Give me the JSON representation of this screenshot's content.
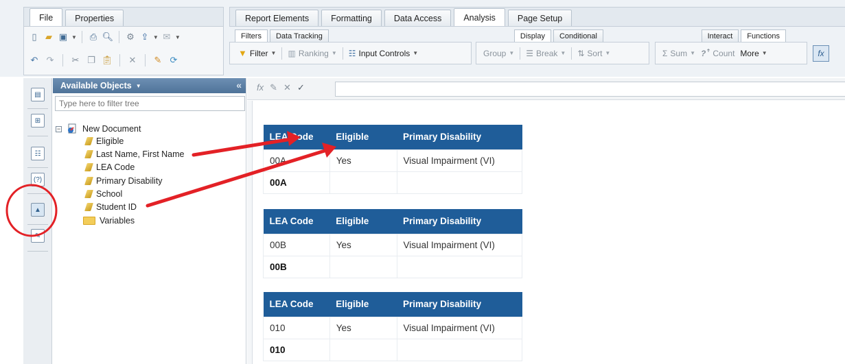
{
  "ribbon": {
    "left_tabs": [
      "File",
      "Properties"
    ],
    "main_tabs": [
      "Report Elements",
      "Formatting",
      "Data Access",
      "Analysis",
      "Page Setup"
    ],
    "active_main_tab": "Analysis",
    "subtabs_left": [
      "Filters",
      "Data Tracking"
    ],
    "subtabs_mid": [
      "Display",
      "Conditional"
    ],
    "subtabs_right": [
      "Interact",
      "Functions"
    ],
    "filter_label": "Filter",
    "ranking_label": "Ranking",
    "input_controls_label": "Input Controls",
    "group_label": "Group",
    "break_label": "Break",
    "sort_label": "Sort",
    "sum_label": "Sum",
    "count_label": "Count",
    "more_label": "More"
  },
  "available_objects": {
    "title": "Available Objects",
    "filter_placeholder": "Type here to filter tree",
    "root": "New Document",
    "items": [
      "Eligible",
      "Last Name, First Name",
      "LEA Code",
      "Primary Disability",
      "School",
      "Student ID"
    ],
    "folder": "Variables"
  },
  "report": {
    "headers": [
      "LEA Code",
      "Eligible",
      "Primary Disability"
    ],
    "tables": [
      {
        "code": "00A",
        "eligible": "Yes",
        "disability": "Visual Impairment (VI)",
        "footer": "00A"
      },
      {
        "code": "00B",
        "eligible": "Yes",
        "disability": "Visual Impairment (VI)",
        "footer": "00B"
      },
      {
        "code": "010",
        "eligible": "Yes",
        "disability": "Visual Impairment (VI)",
        "footer": "010"
      }
    ]
  },
  "colors": {
    "table_header": "#1f5d99",
    "annotation": "#e32126",
    "panel_header": "#5a7da3"
  }
}
